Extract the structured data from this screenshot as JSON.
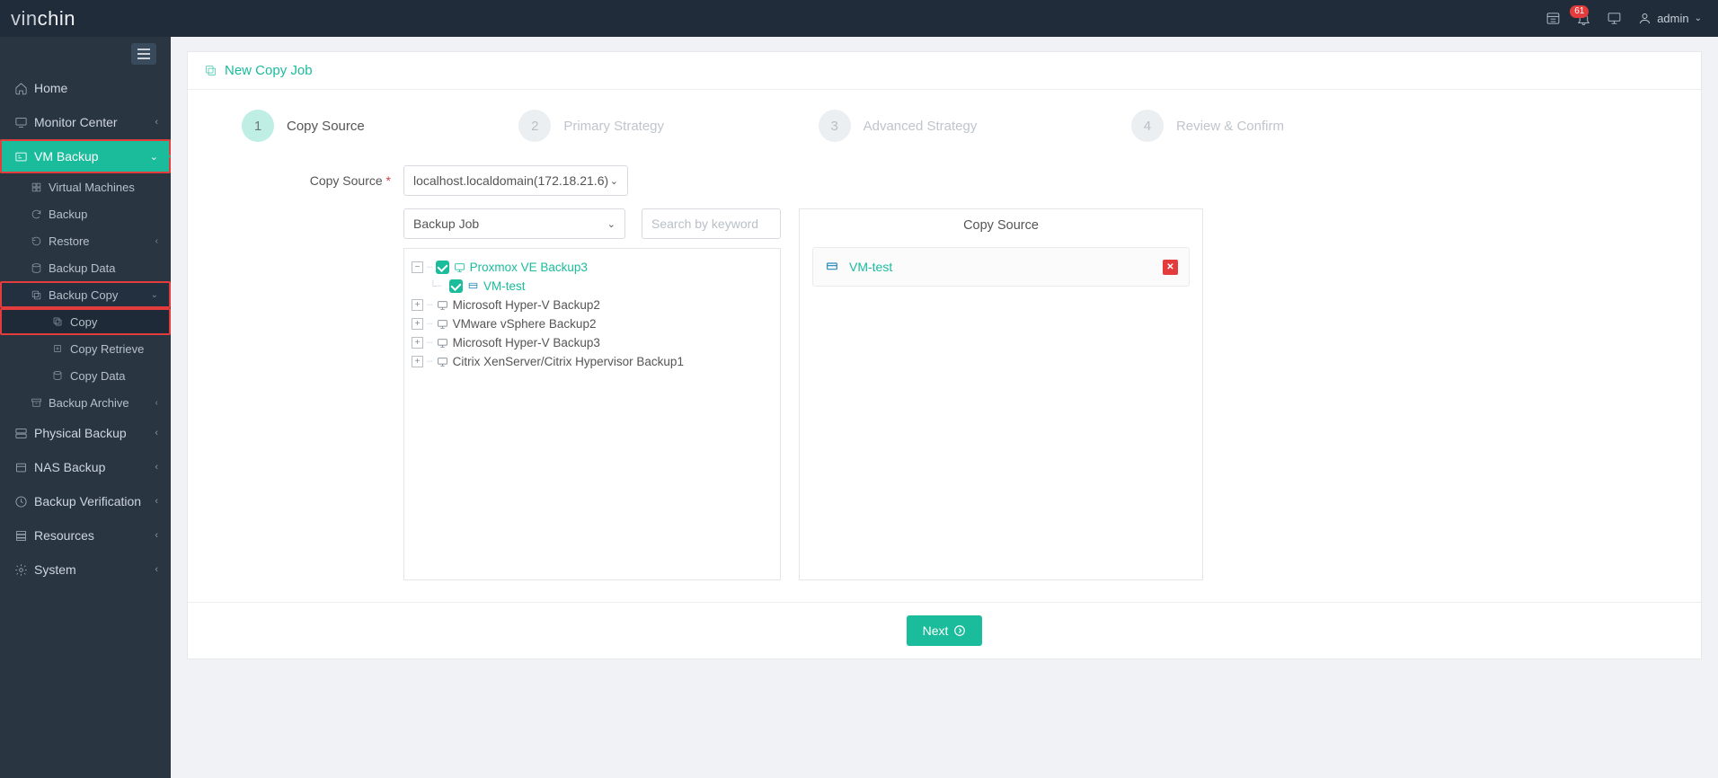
{
  "brand": {
    "left": "vin",
    "right": "chin"
  },
  "topbar": {
    "badge": "61",
    "user": "admin"
  },
  "sidebar": {
    "home": "Home",
    "monitor": "Monitor Center",
    "vm_backup": "VM Backup",
    "virtual_machines": "Virtual Machines",
    "backup": "Backup",
    "restore": "Restore",
    "backup_data": "Backup Data",
    "backup_copy": "Backup Copy",
    "copy": "Copy",
    "copy_retrieve": "Copy Retrieve",
    "copy_data": "Copy Data",
    "backup_archive": "Backup Archive",
    "physical_backup": "Physical Backup",
    "nas_backup": "NAS Backup",
    "backup_verification": "Backup Verification",
    "resources": "Resources",
    "system": "System"
  },
  "page": {
    "title": "New Copy Job",
    "steps": {
      "s1": {
        "num": "1",
        "label": "Copy Source"
      },
      "s2": {
        "num": "2",
        "label": "Primary Strategy"
      },
      "s3": {
        "num": "3",
        "label": "Advanced Strategy"
      },
      "s4": {
        "num": "4",
        "label": "Review & Confirm"
      }
    },
    "form": {
      "copy_source_label": "Copy Source",
      "source_select": "localhost.localdomain(172.18.21.6)",
      "job_select": "Backup Job",
      "search_placeholder": "Search by keyword"
    },
    "tree": {
      "n0": "Proxmox VE Backup3",
      "n0_0": "VM-test",
      "n1": "Microsoft Hyper-V Backup2",
      "n2": "VMware vSphere Backup2",
      "n3": "Microsoft Hyper-V Backup3",
      "n4": "Citrix XenServer/Citrix Hypervisor Backup1"
    },
    "right": {
      "title": "Copy Source",
      "item0": "VM-test"
    },
    "next": "Next"
  }
}
